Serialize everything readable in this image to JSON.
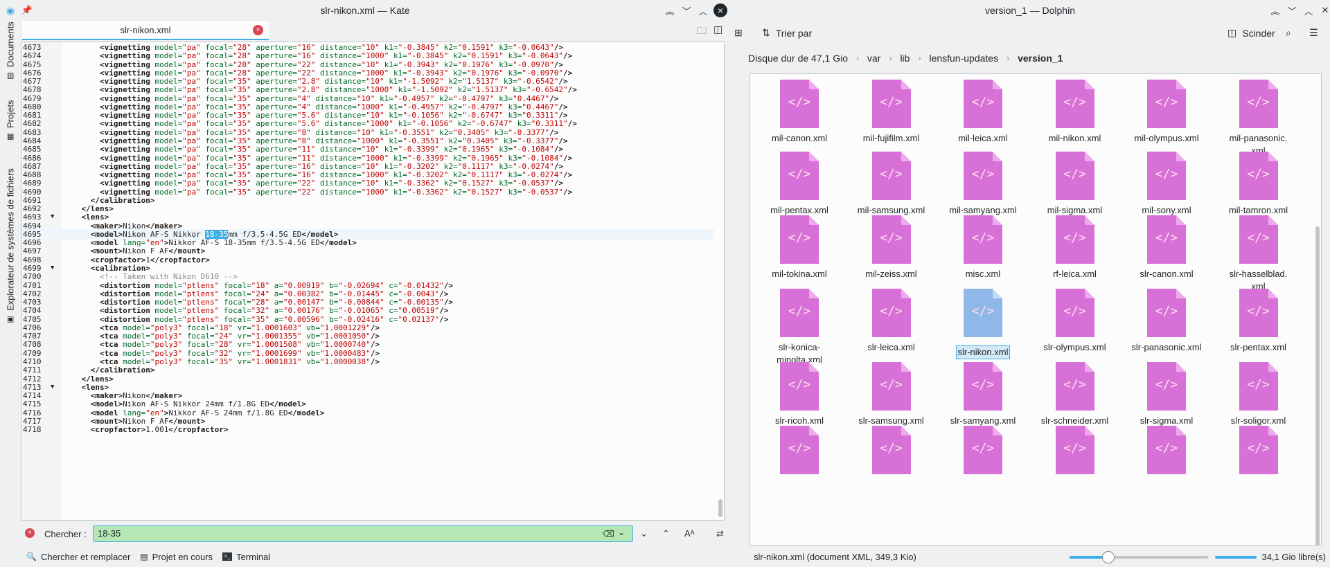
{
  "kate": {
    "title": "slr-nikon.xml — Kate",
    "tab_label": "slr-nikon.xml",
    "sidebar": [
      "Documents",
      "Projets",
      "Explorateur de systèmes de fichiers"
    ],
    "lines": [
      [
        "4673",
        "",
        "        ",
        "vig",
        "pa",
        "28",
        "16",
        "10",
        "-0.3845",
        "0.1591",
        "-0.0643"
      ],
      [
        "4674",
        "",
        "        ",
        "vig",
        "pa",
        "28",
        "16",
        "1000",
        "-0.3845",
        "0.1591",
        "-0.0643"
      ],
      [
        "4675",
        "",
        "        ",
        "vig",
        "pa",
        "28",
        "22",
        "10",
        "-0.3943",
        "0.1976",
        "-0.0970"
      ],
      [
        "4676",
        "",
        "        ",
        "vig",
        "pa",
        "28",
        "22",
        "1000",
        "-0.3943",
        "0.1976",
        "-0.0970"
      ],
      [
        "4677",
        "",
        "        ",
        "vig",
        "pa",
        "35",
        "2.8",
        "10",
        "-1.5092",
        "1.5137",
        "-0.6542"
      ],
      [
        "4678",
        "",
        "        ",
        "vig",
        "pa",
        "35",
        "2.8",
        "1000",
        "-1.5092",
        "1.5137",
        "-0.6542"
      ],
      [
        "4679",
        "",
        "        ",
        "vig",
        "pa",
        "35",
        "4",
        "10",
        "-0.4957",
        "-0.4797",
        "0.4467"
      ],
      [
        "4680",
        "",
        "        ",
        "vig",
        "pa",
        "35",
        "4",
        "1000",
        "-0.4957",
        "-0.4797",
        "0.4467"
      ],
      [
        "4681",
        "",
        "        ",
        "vig",
        "pa",
        "35",
        "5.6",
        "10",
        "-0.1056",
        "-0.6747",
        "0.3311"
      ],
      [
        "4682",
        "",
        "        ",
        "vig",
        "pa",
        "35",
        "5.6",
        "1000",
        "-0.1056",
        "-0.6747",
        "0.3311"
      ],
      [
        "4683",
        "",
        "        ",
        "vig",
        "pa",
        "35",
        "8",
        "10",
        "-0.3551",
        "0.3405",
        "-0.3377"
      ],
      [
        "4684",
        "",
        "        ",
        "vig",
        "pa",
        "35",
        "8",
        "1000",
        "-0.3551",
        "0.3405",
        "-0.3377"
      ],
      [
        "4685",
        "",
        "        ",
        "vig",
        "pa",
        "35",
        "11",
        "10",
        "-0.3399",
        "0.1965",
        "-0.1084"
      ],
      [
        "4686",
        "",
        "        ",
        "vig",
        "pa",
        "35",
        "11",
        "1000",
        "-0.3399",
        "0.1965",
        "-0.1084"
      ],
      [
        "4687",
        "",
        "        ",
        "vig",
        "pa",
        "35",
        "16",
        "10",
        "-0.3202",
        "0.1117",
        "-0.0274"
      ],
      [
        "4688",
        "",
        "        ",
        "vig",
        "pa",
        "35",
        "16",
        "1000",
        "-0.3202",
        "0.1117",
        "-0.0274"
      ],
      [
        "4689",
        "",
        "        ",
        "vig",
        "pa",
        "35",
        "22",
        "10",
        "-0.3362",
        "0.1527",
        "-0.0537"
      ],
      [
        "4690",
        "",
        "        ",
        "vig",
        "pa",
        "35",
        "22",
        "1000",
        "-0.3362",
        "0.1527",
        "-0.0537"
      ],
      [
        "4691",
        "",
        "      ",
        "raw",
        "</calibration>"
      ],
      [
        "4692",
        "",
        "    ",
        "raw",
        "</lens>"
      ],
      [
        "4693",
        "▼",
        "    ",
        "raw",
        "<lens>"
      ],
      [
        "4694",
        "",
        "      ",
        "tagtext",
        "maker",
        "Nikon"
      ],
      [
        "4695",
        "",
        "      ",
        "model_hl",
        "Nikon AF-S Nikkor ",
        "18-35",
        "mm f/3.5-4.5G ED"
      ],
      [
        "4696",
        "",
        "      ",
        "model_lang",
        "en",
        "Nikkor AF-S 18-35mm f/3.5-4.5G ED"
      ],
      [
        "4697",
        "",
        "      ",
        "tagtext",
        "mount",
        "Nikon F AF"
      ],
      [
        "4698",
        "",
        "      ",
        "tagtext",
        "cropfactor",
        "1"
      ],
      [
        "4699",
        "▼",
        "      ",
        "raw",
        "<calibration>"
      ],
      [
        "4700",
        "",
        "        ",
        "comment",
        "<!-- Taken with Nikon D610 -->"
      ],
      [
        "4701",
        "",
        "        ",
        "dist",
        "18",
        "0.00919",
        "-0.02694",
        "-0.01432"
      ],
      [
        "4702",
        "",
        "        ",
        "dist",
        "24",
        "0.00382",
        "-0.01445",
        "-0.0043"
      ],
      [
        "4703",
        "",
        "        ",
        "dist",
        "28",
        "0.00147",
        "-0.00844",
        "-0.00135"
      ],
      [
        "4704",
        "",
        "        ",
        "dist",
        "32",
        "0.00176",
        "-0.01065",
        "0.00519"
      ],
      [
        "4705",
        "",
        "        ",
        "dist",
        "35",
        "0.00596",
        "-0.02416",
        "0.02137"
      ],
      [
        "4706",
        "",
        "        ",
        "tca",
        "18",
        "1.0001603",
        "1.0001229"
      ],
      [
        "4707",
        "",
        "        ",
        "tca",
        "24",
        "1.0001355",
        "1.0001050"
      ],
      [
        "4708",
        "",
        "        ",
        "tca",
        "28",
        "1.0001508",
        "1.0000740"
      ],
      [
        "4709",
        "",
        "        ",
        "tca",
        "32",
        "1.0001699",
        "1.0000483"
      ],
      [
        "4710",
        "",
        "        ",
        "tca",
        "35",
        "1.0001831",
        "1.0000038"
      ],
      [
        "4711",
        "",
        "      ",
        "raw",
        "</calibration>"
      ],
      [
        "4712",
        "",
        "    ",
        "raw",
        "</lens>"
      ],
      [
        "4713",
        "▼",
        "    ",
        "raw",
        "<lens>"
      ],
      [
        "4714",
        "",
        "      ",
        "tagtext",
        "maker",
        "Nikon"
      ],
      [
        "4715",
        "",
        "      ",
        "tagtext",
        "model",
        "Nikon AF-S Nikkor 24mm f/1.8G ED"
      ],
      [
        "4716",
        "",
        "      ",
        "model_lang",
        "en",
        "Nikkor AF-S 24mm f/1.8G ED"
      ],
      [
        "4717",
        "",
        "      ",
        "tagtext",
        "mount",
        "Nikon F AF"
      ],
      [
        "4718",
        "",
        "      ",
        "tagtext",
        "cropfactor",
        "1.001"
      ]
    ],
    "search": {
      "label": "Chercher :",
      "value": "18-35"
    },
    "status": {
      "search_replace": "Chercher et remplacer",
      "project": "Projet en cours",
      "terminal": "Terminal"
    }
  },
  "dolphin": {
    "title": "version_1 — Dolphin",
    "sort_label": "Trier par",
    "split_label": "Scinder",
    "breadcrumbs": [
      "Disque dur de 47,1 Gio",
      "var",
      "lib",
      "lensfun-updates",
      "version_1"
    ],
    "files": [
      "mil-canon.xml",
      "mil-fujifilm.xml",
      "mil-leica.xml",
      "mil-nikon.xml",
      "mil-olympus.xml",
      "mil-panasonic.\nxml",
      "mil-pentax.xml",
      "mil-samsung.xml",
      "mil-samyang.xml",
      "mil-sigma.xml",
      "mil-sony.xml",
      "mil-tamron.xml",
      "mil-tokina.xml",
      "mil-zeiss.xml",
      "misc.xml",
      "rf-leica.xml",
      "slr-canon.xml",
      "slr-hasselblad.\nxml",
      "slr-konica-\nminolta.xml",
      "slr-leica.xml",
      "slr-nikon.xml",
      "slr-olympus.xml",
      "slr-panasonic.xml",
      "slr-pentax.xml",
      "slr-ricoh.xml",
      "slr-samsung.xml",
      "slr-samyang.xml",
      "slr-schneider.xml",
      "slr-sigma.xml",
      "slr-soligor.xml",
      "",
      "",
      "",
      "",
      "",
      ""
    ],
    "selected_file": "slr-nikon.xml",
    "status_text": "slr-nikon.xml (document XML, 349,3 Kio)",
    "free_space": "34,1 Gio libre(s)",
    "zoom_level": 0.28
  }
}
